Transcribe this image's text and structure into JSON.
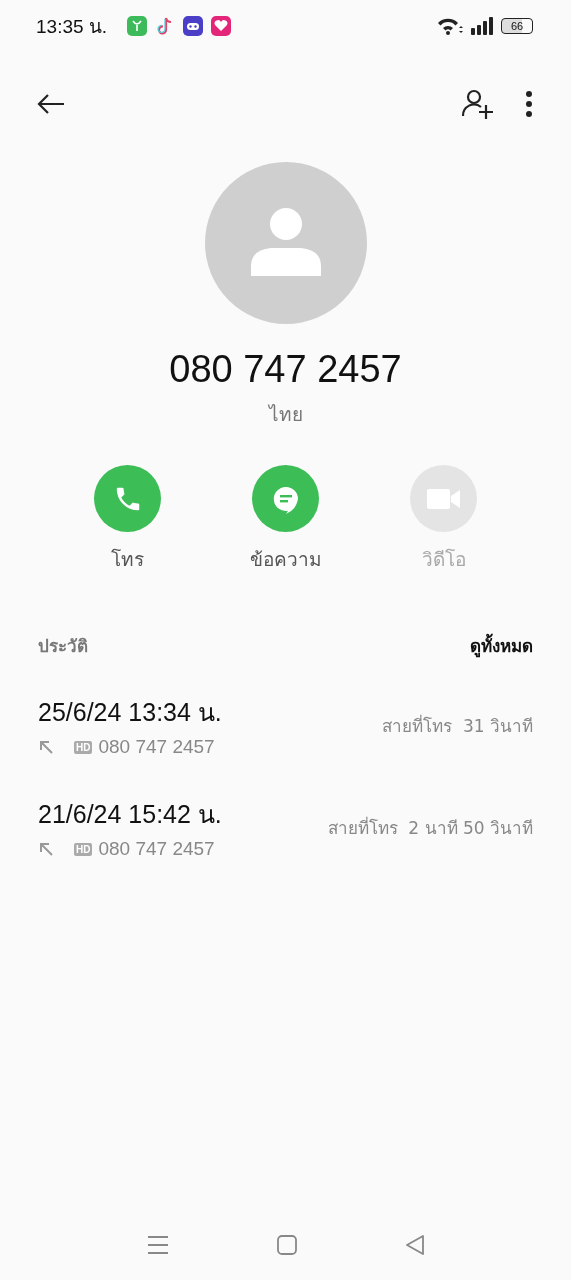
{
  "status_bar": {
    "time": "13:35 น.",
    "battery": "66"
  },
  "contact": {
    "number": "080 747 2457",
    "location": "ไทย"
  },
  "actions": [
    {
      "kind": "call",
      "label": "โทร",
      "disabled": false
    },
    {
      "kind": "message",
      "label": "ข้อความ",
      "disabled": false
    },
    {
      "kind": "video",
      "label": "วิดีโอ",
      "disabled": true
    }
  ],
  "history": {
    "title": "ประวัติ",
    "see_all": "ดูทั้งหมด",
    "calls": [
      {
        "datetime": "25/6/24 13:34 น.",
        "badge": "HD",
        "number": "080 747 2457",
        "duration": "สายที่โทร  31 วินาที"
      },
      {
        "datetime": "21/6/24 15:42 น.",
        "badge": "HD",
        "number": "080 747 2457",
        "duration": "สายที่โทร  2 นาที 50 วินาที"
      }
    ]
  }
}
